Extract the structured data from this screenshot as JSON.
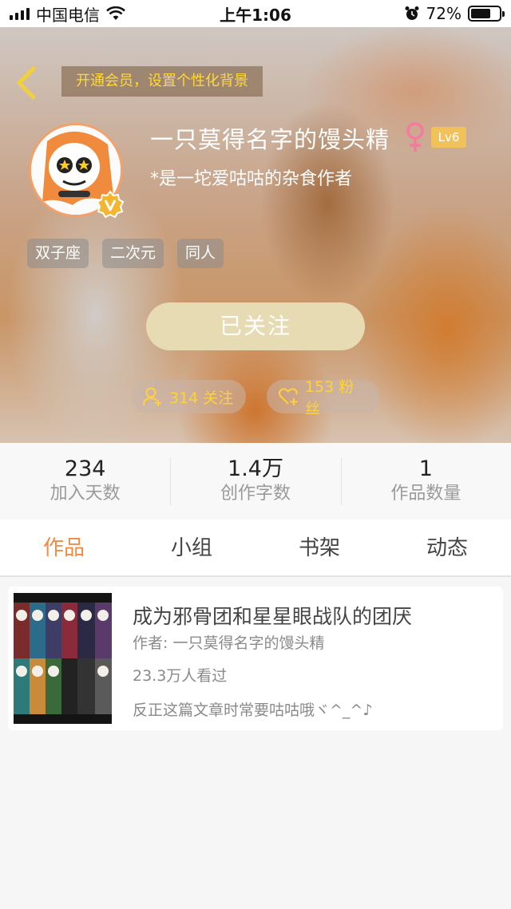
{
  "status_bar": {
    "carrier": "中国电信",
    "time": "上午1:06",
    "battery_percent": "72%",
    "battery_level": 0.72
  },
  "profile": {
    "vip_banner": "开通会员，设置个性化背景",
    "username": "一只莫得名字的馒头精",
    "gender_icon": "female-icon",
    "level": "Lv6",
    "bio": "*是一坨爱咕咕的杂食作者",
    "tags": [
      "双子座",
      "二次元",
      "同人"
    ],
    "follow_button": "已关注",
    "following_label": "314 关注",
    "fans_label": "153 粉丝"
  },
  "stats": [
    {
      "value": "234",
      "label": "加入天数"
    },
    {
      "value": "1.4万",
      "label": "创作字数"
    },
    {
      "value": "1",
      "label": "作品数量"
    }
  ],
  "tabs": [
    {
      "label": "作品",
      "active": true
    },
    {
      "label": "小组",
      "active": false
    },
    {
      "label": "书架",
      "active": false
    },
    {
      "label": "动态",
      "active": false
    }
  ],
  "works": [
    {
      "title": "成为邪骨团和星星眼战队的团厌",
      "author": "作者: 一只莫得名字的馒头精",
      "views": "23.3万人看过",
      "description": "反正这篇文章时常要咕咕哦ヾ^_^♪"
    }
  ],
  "colors": {
    "accent": "#ef8b45",
    "gold": "#ffd23a",
    "follow_button": "#e7dbb4",
    "level_badge": "#f2c25a"
  }
}
